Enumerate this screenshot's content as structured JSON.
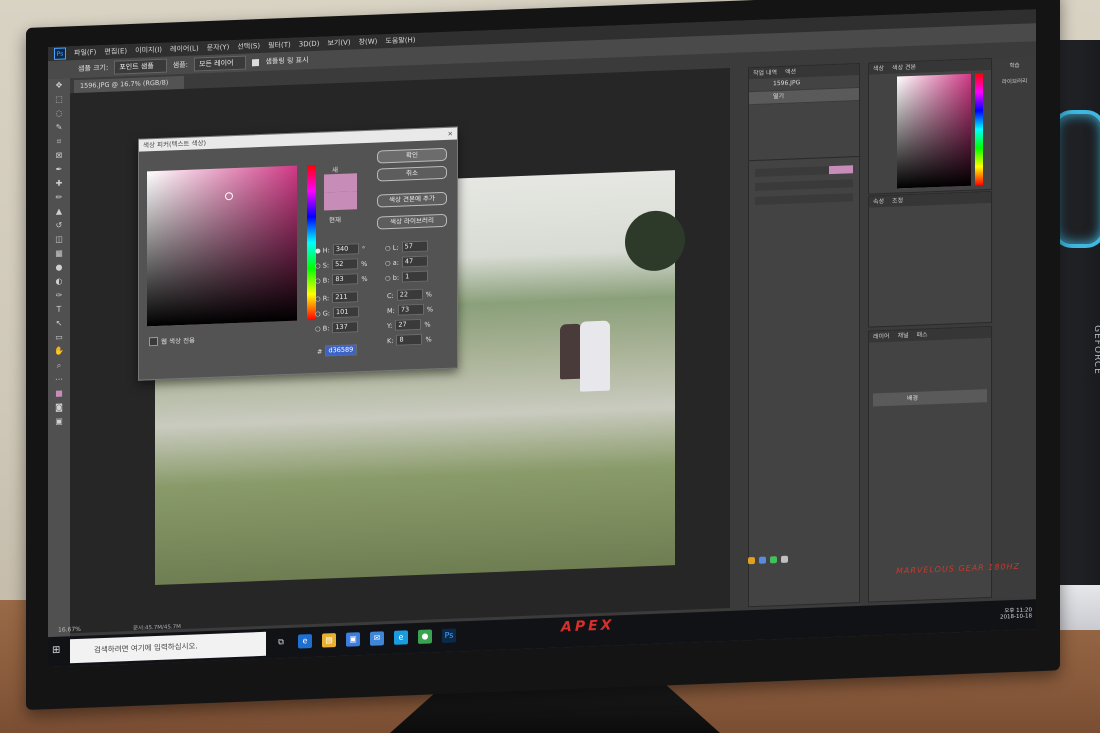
{
  "photoshop": {
    "logo": "Ps",
    "menu": [
      "파일(F)",
      "편집(E)",
      "이미지(I)",
      "레이어(L)",
      "문자(Y)",
      "선택(S)",
      "필터(T)",
      "3D(D)",
      "보기(V)",
      "창(W)",
      "도움말(H)"
    ],
    "options": {
      "sample_size_label": "샘플 크기:",
      "sample_size_value": "포인트 샘플",
      "sample_label": "샘플:",
      "sample_value": "모든 레이어",
      "show_ring_label": "샘플링 링 표시"
    },
    "document_tab": "1596.JPG @ 16.7% (RGB/8)",
    "status_zoom": "16.67%",
    "status_doc": "문서:45.7M/45.7M"
  },
  "color_picker": {
    "title": "색상 피커(텍스트 색상)",
    "close": "×",
    "new_label": "새",
    "current_label": "현재",
    "ok": "확인",
    "cancel": "취소",
    "add_swatch": "색상 견본에 추가",
    "libraries": "색상 라이브러리",
    "web_only": "웹 색상 전용",
    "fields": {
      "H": "340",
      "S": "52",
      "B": "83",
      "R": "211",
      "G": "101",
      "Bb": "137",
      "L": "57",
      "a": "47",
      "b": "1",
      "C": "22",
      "M": "73",
      "Y": "27",
      "K": "8"
    },
    "units": {
      "deg": "°",
      "pct": "%"
    },
    "hex": "d36589",
    "hex_label": "#",
    "new_color": "#c88cb8",
    "current_color": "#c88cb8"
  },
  "history_panel": {
    "tabs": [
      "작업 내역",
      "액션"
    ],
    "items": [
      "1596.JPG",
      "열기"
    ]
  },
  "color_panel": {
    "tabs": [
      "색상",
      "색상 견본"
    ]
  },
  "properties_panel": {
    "tabs": [
      "속성",
      "조정"
    ]
  },
  "layers_panel": {
    "tabs": [
      "레이어",
      "채널",
      "패스"
    ],
    "layer": "배경"
  },
  "side_dock": {
    "items": [
      "학습",
      "라이브러리"
    ]
  },
  "taskbar": {
    "search_placeholder": "검색하려면 여기에 입력하십시오.",
    "time": "오후 11:20",
    "date": "2018-10-18"
  },
  "monitor": {
    "brand": "APEX",
    "tagline": "MARVELOUS GEAR 180HZ"
  },
  "pc": {
    "label": "GEFORCE"
  }
}
